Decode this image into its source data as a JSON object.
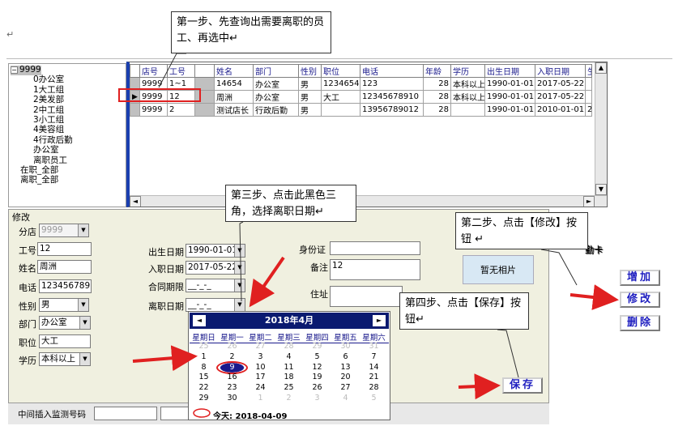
{
  "page": {
    "mark": "↵"
  },
  "tree": {
    "items": [
      "9999",
      "0办公室",
      "1大工组",
      "2美发部",
      "2中工组",
      "3小工组",
      "4美容组",
      "4行政后勤",
      "办公室",
      "离职员工",
      "在职_全部",
      "离职_全部"
    ]
  },
  "grid": {
    "columns": [
      "店号",
      "工号",
      "",
      "姓名",
      "部门",
      "性别",
      "职位",
      "电话",
      "年龄",
      "学历",
      "出生日期",
      "入职日期",
      "生"
    ],
    "rows": [
      [
        "9999",
        "1~1",
        "",
        "14654",
        "办公室",
        "男",
        "123465464",
        "123",
        "28",
        "本科以上",
        "1990-01-01",
        "2017-05-22",
        ""
      ],
      [
        "9999",
        "12",
        "",
        "周洲",
        "办公室",
        "男",
        "大工",
        "12345678910",
        "28",
        "本科以上",
        "1990-01-01",
        "2017-05-22",
        ""
      ],
      [
        "9999",
        "2",
        "",
        "测试店长",
        "行政后勤",
        "男",
        "",
        "13956789012",
        "28",
        "",
        "1990-01-01",
        "2010-01-01",
        "2"
      ]
    ]
  },
  "form": {
    "title": "修改",
    "shop_label": "分店",
    "shop_value": "9999",
    "empno_label": "工号",
    "empno_value": "12",
    "name_label": "姓名",
    "name_value": "周洲",
    "phone_label": "电话",
    "phone_value": "12345678910",
    "gender_label": "性别",
    "gender_value": "男",
    "dept_label": "部门",
    "dept_value": "办公室",
    "position_label": "职位",
    "position_value": "大工",
    "edu_label": "学历",
    "edu_value": "本科以上",
    "birth_label": "出生日期",
    "birth_value": "1990-01-01",
    "hire_label": "入职日期",
    "hire_value": "2017-05-22",
    "contract_label": "合同期限",
    "contract_value": "__-_-_",
    "leave_label": "离职日期",
    "leave_value": "__-_-_",
    "id_label": "身份证",
    "id_value": "",
    "note_label": "备注",
    "note_value": "12",
    "addr_label": "住址",
    "addr_value": "",
    "photo_text": "暂无相片",
    "attendance_label": "勤卡"
  },
  "buttons": {
    "add": "增加",
    "edit": "修改",
    "delete": "删除",
    "save": "保存"
  },
  "calendar": {
    "title": "2018年4月",
    "weekdays": [
      "星期日",
      "星期一",
      "星期二",
      "星期三",
      "星期四",
      "星期五",
      "星期六"
    ],
    "weeks": [
      [
        "25",
        "26",
        "27",
        "28",
        "29",
        "30",
        "31"
      ],
      [
        "1",
        "2",
        "3",
        "4",
        "5",
        "6",
        "7"
      ],
      [
        "8",
        "9",
        "10",
        "11",
        "12",
        "13",
        "14"
      ],
      [
        "15",
        "16",
        "17",
        "18",
        "19",
        "20",
        "21"
      ],
      [
        "22",
        "23",
        "24",
        "25",
        "26",
        "27",
        "28"
      ],
      [
        "29",
        "30",
        "1",
        "2",
        "3",
        "4",
        "5"
      ]
    ],
    "dim": [
      [
        1,
        1,
        1,
        1,
        1,
        1,
        1
      ],
      [
        0,
        0,
        0,
        0,
        0,
        0,
        0
      ],
      [
        0,
        0,
        0,
        0,
        0,
        0,
        0
      ],
      [
        0,
        0,
        0,
        0,
        0,
        0,
        0
      ],
      [
        0,
        0,
        0,
        0,
        0,
        0,
        0
      ],
      [
        0,
        0,
        1,
        1,
        1,
        1,
        1
      ]
    ],
    "selected": "9",
    "today_text": "今天: 2018-04-09"
  },
  "bottom": {
    "label": "中间插入监测号码"
  },
  "callouts": {
    "step1": "第一步、先查询出需要离职的员工、再选中↵",
    "step2": "第二步、点击【修改】按钮 ↵",
    "step3": "第三步、点击此黑色三角，选择离职日期↵",
    "step4": "第四步、点击【保存】按钮↵"
  },
  "colors": {
    "highlight": "#e02020",
    "arrow": "#e02020",
    "calendar_header": "#0a1a70",
    "button_text": "#2020c0"
  }
}
